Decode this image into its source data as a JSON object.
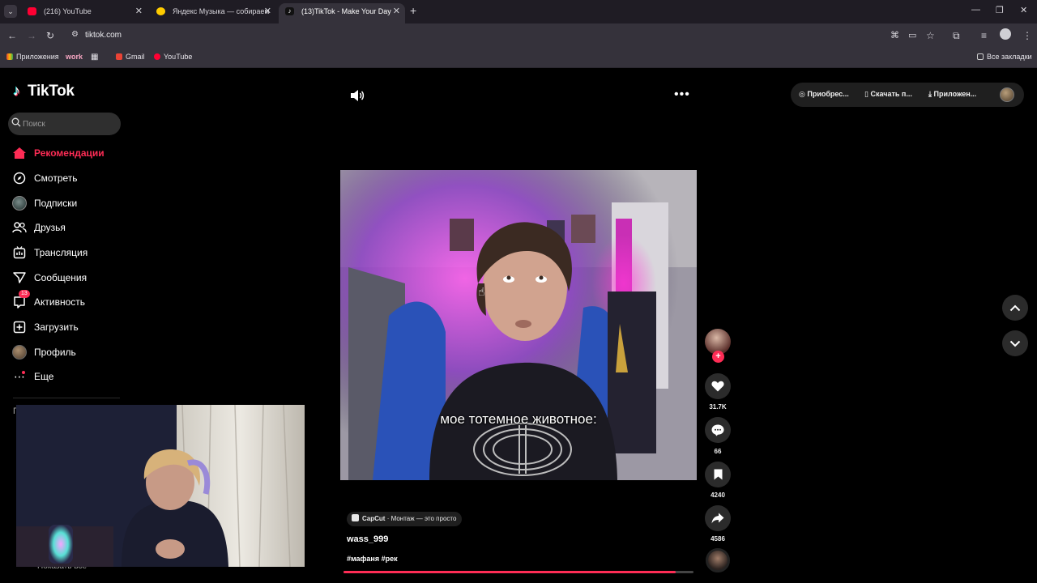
{
  "browser": {
    "tabs": [
      {
        "title": "(216) YouTube",
        "active": false
      },
      {
        "title": "Яндекс Музыка — собираем м",
        "active": false
      },
      {
        "title": "(13)TikTok - Make Your Day",
        "active": true
      }
    ],
    "url": "tiktok.com",
    "bookmarks": [
      "Приложения",
      "work",
      "Gmail",
      "YouTube"
    ],
    "all_bookmarks": "Все закладки"
  },
  "tiktok": {
    "logo": "TikTok",
    "search_placeholder": "Поиск",
    "nav": [
      {
        "label": "Рекомендации",
        "icon": "home-icon",
        "active": true
      },
      {
        "label": "Смотреть",
        "icon": "compass-icon",
        "active": false
      },
      {
        "label": "Подписки",
        "icon": "following-avatar-icon",
        "active": false
      },
      {
        "label": "Друзья",
        "icon": "friends-icon",
        "active": false
      },
      {
        "label": "Трансляция",
        "icon": "live-icon",
        "active": false
      },
      {
        "label": "Сообщения",
        "icon": "messages-icon",
        "active": false
      },
      {
        "label": "Активность",
        "icon": "activity-icon",
        "active": false,
        "badge": "13"
      },
      {
        "label": "Загрузить",
        "icon": "upload-icon",
        "active": false
      },
      {
        "label": "Профиль",
        "icon": "profile-avatar-icon",
        "active": false
      },
      {
        "label": "Еще",
        "icon": "more-icon",
        "active": false
      }
    ],
    "follow_header": "П",
    "show_all": "Показать все",
    "top_actions": {
      "buy": "Приобрес...",
      "download": "Скачать п...",
      "app": "Приложен..."
    },
    "video": {
      "caption": "мое тотемное животное:",
      "capcut_brand": "CapCut",
      "capcut_text": "· Монтаж — это просто",
      "author": "wass_999",
      "hashtags": "#мафаня #рек",
      "progress": 0.95,
      "likes": "31.7K",
      "comments": "66",
      "saves": "4240",
      "shares": "4586"
    }
  },
  "colors": {
    "accent": "#fe2c55",
    "page_bg": "#000000",
    "chrome_bg": "#35323b"
  }
}
